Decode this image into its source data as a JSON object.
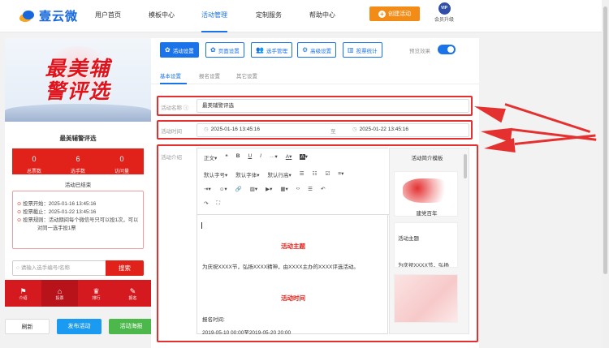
{
  "brand": {
    "name": "壹云微"
  },
  "nav": {
    "items": [
      {
        "label": "用户首页"
      },
      {
        "label": "模板中心"
      },
      {
        "label": "活动管理"
      },
      {
        "label": "定制服务"
      },
      {
        "label": "帮助中心"
      }
    ],
    "active_index": 2,
    "create_button": "创建活动",
    "vip_badge": "VIP",
    "vip_label": "会员升级"
  },
  "preview": {
    "banner_line1": "最美辅",
    "banner_line2": "警评选",
    "title": "最美辅警评选",
    "stats": [
      {
        "value": "0",
        "label": "总票数"
      },
      {
        "value": "6",
        "label": "选手数"
      },
      {
        "value": "0",
        "label": "访问量"
      }
    ],
    "status": "活动已结束",
    "info": [
      {
        "text": "投票开始：2025-01-16 13:45:16"
      },
      {
        "text": "投票截止：2025-01-22 13:45:16"
      },
      {
        "text": "投票规则：活动期间每个微信号只可以投1次，可以"
      },
      {
        "text": "对同一选手投1票"
      }
    ],
    "search_placeholder": "请输入选手编号/名称",
    "search_button": "搜索",
    "tabbar": [
      {
        "label": "介绍"
      },
      {
        "label": "投票"
      },
      {
        "label": "排行"
      },
      {
        "label": "报名"
      }
    ]
  },
  "bottom_buttons": {
    "refresh": "刷新",
    "publish": "发布活动",
    "poster": "活动海报"
  },
  "toolbar": {
    "buttons": [
      {
        "label": "活动设置"
      },
      {
        "label": "页面设置"
      },
      {
        "label": "选手管理"
      },
      {
        "label": "高级设置"
      },
      {
        "label": "投票统计"
      }
    ],
    "preview_label": "预览效果"
  },
  "subtabs": [
    {
      "label": "基本设置"
    },
    {
      "label": "报名设置"
    },
    {
      "label": "其它设置"
    }
  ],
  "form": {
    "name_label": "活动名称",
    "name_value": "最美辅警评选",
    "time_label": "活动时间",
    "start_time": "2025-01-16 13:45:16",
    "to_label": "至",
    "end_time": "2025-01-22 13:45:16",
    "intro_label": "活动介绍"
  },
  "editor": {
    "row1": {
      "paragraph": "正文",
      "quote": "❝",
      "bold": "B",
      "underline": "U",
      "italic": "I",
      "more": "···",
      "font_color": "A",
      "bg_color": "A"
    },
    "row2": {
      "size": "默认字号",
      "family": "默认字体",
      "line_height": "默认行高"
    },
    "content": {
      "heading1": "活动主题",
      "paragraph1": "为庆祝XXXX节，弘扬XXXX精神，由XXXX主办的XXXX评选活动。",
      "heading2": "活动时间",
      "line1": "报名时间:",
      "line2": "2019-05-10 00:00至2019-05-20 20:00"
    }
  },
  "templates": {
    "title": "活动简介模板",
    "cards": [
      {
        "caption": "建党百年"
      },
      {
        "title": "活动主题",
        "body": "为庆祝XXXX节，弘扬"
      },
      {
        "caption": ""
      }
    ]
  }
}
